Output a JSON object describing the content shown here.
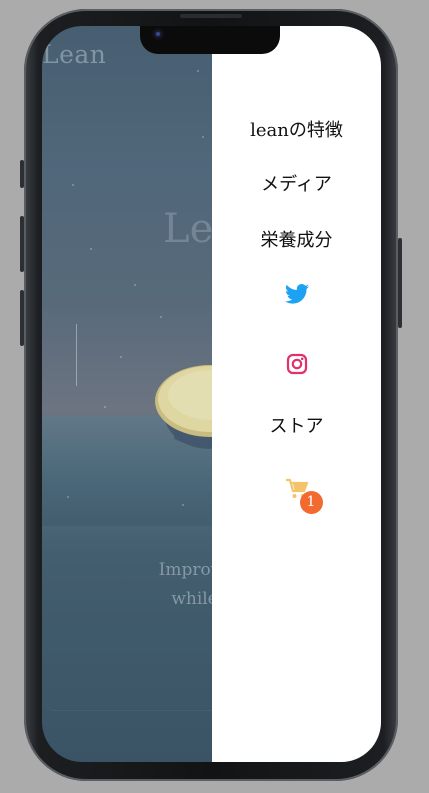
{
  "background_page": {
    "logo": "Lean",
    "hero_title": "Le",
    "tagline_line1": "Improve y",
    "tagline_line2": "while c"
  },
  "menu": {
    "items": [
      {
        "label": "leanの特徴"
      },
      {
        "label": "メディア"
      },
      {
        "label": "栄養成分"
      },
      {
        "label": "ストア"
      }
    ],
    "twitter_icon": "twitter-icon",
    "instagram_icon": "instagram-icon",
    "cart_icon": "cart-icon",
    "cart_count": "1"
  },
  "colors": {
    "twitter": "#1da1f2",
    "instagram": "#e1306c",
    "cart": "#f5c46a",
    "badge": "#f26a2f",
    "menu_bg": "#ffffff"
  }
}
